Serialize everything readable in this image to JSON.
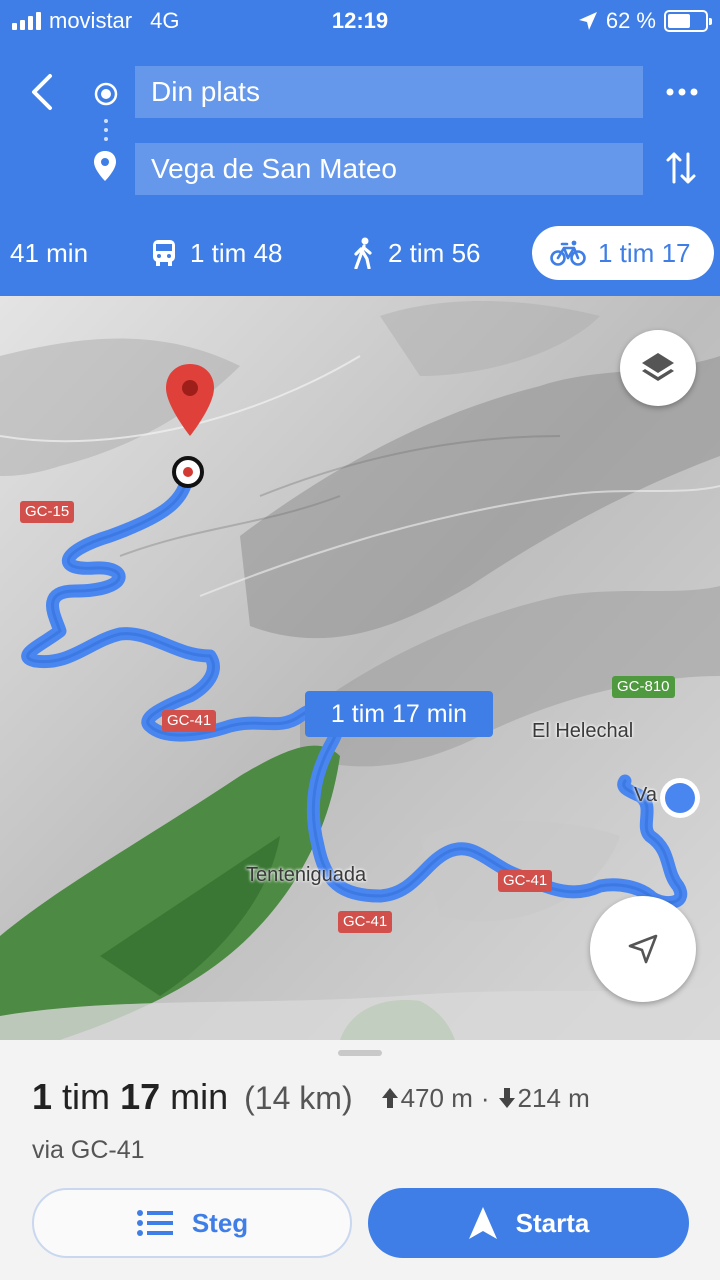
{
  "status_bar": {
    "carrier": "movistar",
    "network": "4G",
    "time": "12:19",
    "battery_text": "62 %",
    "battery_level_percent": 62
  },
  "search": {
    "origin": "Din plats",
    "destination": "Vega de San Mateo"
  },
  "modes": {
    "car": "41 min",
    "transit": "1 tim 48",
    "walk": "2 tim 56",
    "bike": "1 tim 17",
    "selected": "bike"
  },
  "map": {
    "route_duration": "1 tim 17 min",
    "road_labels": [
      "GC-15",
      "GC-41",
      "GC-41",
      "GC-41",
      "GC-810"
    ],
    "places": [
      "El Helechal",
      "Tenteniguada",
      "Va"
    ],
    "route_color": "#4a86f0",
    "destination_pin_color": "#e0403a"
  },
  "summary": {
    "duration_hours": "1",
    "duration_hours_unit": "tim",
    "duration_minutes": "17",
    "duration_minutes_unit": "min",
    "distance": "(14 km)",
    "ascent": "470 m",
    "separator": "·",
    "descent": "214 m",
    "via": "via GC-41"
  },
  "buttons": {
    "steps": "Steg",
    "start": "Starta"
  },
  "colors": {
    "accent": "#3f7ee6",
    "sheet_background": "#f3f3f3"
  },
  "icons": [
    "back-icon",
    "origin-icon",
    "destination-pin-icon",
    "more-icon",
    "swap-icon",
    "transit-icon",
    "walk-icon",
    "bike-icon",
    "layers-icon",
    "locate-icon",
    "list-icon",
    "navigation-arrow-icon",
    "arrow-up-icon",
    "arrow-down-icon"
  ]
}
